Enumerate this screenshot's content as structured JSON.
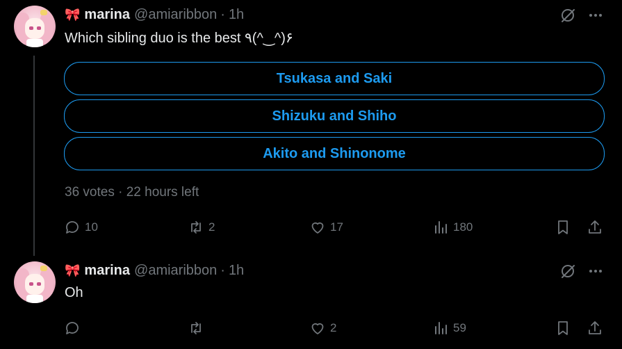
{
  "tweets": [
    {
      "user": {
        "emoji": "🎀",
        "name": "marina",
        "handle": "@amiaribbon",
        "time": "1h"
      },
      "text": "Which sibling duo is the best ٩(^‿^)۶",
      "poll": {
        "options": [
          "Tsukasa and Saki",
          "Shizuku and Shiho",
          "Akito and Shinonome"
        ],
        "meta": "36 votes · 22 hours left"
      },
      "stats": {
        "replies": "10",
        "retweets": "2",
        "likes": "17",
        "views": "180"
      }
    },
    {
      "user": {
        "emoji": "🎀",
        "name": "marina",
        "handle": "@amiaribbon",
        "time": "1h"
      },
      "text": "Oh",
      "stats": {
        "replies": "",
        "retweets": "",
        "likes": "2",
        "views": "59"
      }
    }
  ],
  "colors": {
    "background": "#000000",
    "text": "#e7e9ea",
    "muted": "#71767b",
    "accent": "#1d9bf0"
  }
}
